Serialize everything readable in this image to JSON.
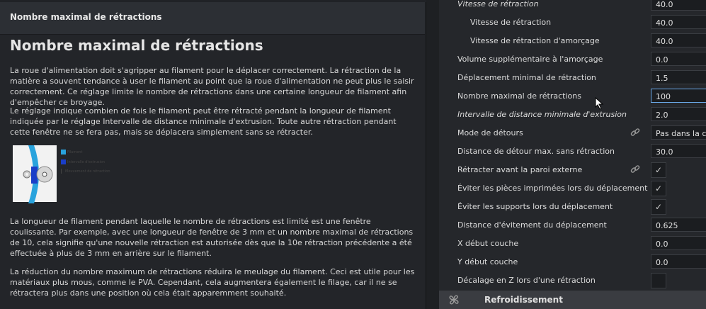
{
  "tooltip": {
    "header_title": "Nombre maximal de rétractions",
    "title": "Nombre maximal de rétractions",
    "paragraphs": [
      "La roue d'alimentation doit s'agripper au filament pour le déplacer correctement. La rétraction de la matière a souvent tendance à user le filament au point que la roue d'alimentation ne peut plus le saisir correctement. Ce réglage limite le nombre de rétractions dans une certaine longueur de filament afin d'empêcher ce broyage.",
      "Le réglage indique combien de fois le filament peut être rétracté pendant la longueur de filament indiquée par le réglage Intervalle de distance minimale d'extrusion. Toute autre rétraction pendant cette fenêtre ne se fera pas, mais se déplacera simplement sans se rétracter.",
      "La longueur de filament pendant laquelle le nombre de rétractions est limité est une fenêtre coulissante. Par exemple, avec une longueur de fenêtre de 3 mm et un nombre maximal de rétractions de 10, cela signifie qu'une nouvelle rétraction est autorisée dès que la 10e rétraction précédente a été effectuée à plus de 3 mm en arrière sur le filament.",
      "La réduction du nombre maximum de rétractions réduira le meulage du filament. Ceci est utile pour les matériaux plus mous, comme le PVA. Cependant, cela augmentera également le filage, car il ne se rétractera plus dans une position où cela était apparemment souhaité."
    ],
    "diagram_legend": [
      "Filament",
      "Intervalle d'extrusion",
      "Mouvement de rétraction"
    ],
    "colors": {
      "filament": "#29a3dd",
      "interval": "#1a3ec8"
    }
  },
  "settings": {
    "rows": [
      {
        "label": "Vitesse de rétraction",
        "value": "40.0",
        "indent": false,
        "italic": true,
        "kind": "field"
      },
      {
        "label": "Vitesse de rétraction",
        "value": "40.0",
        "indent": true,
        "italic": false,
        "kind": "field"
      },
      {
        "label": "Vitesse de rétraction d'amorçage",
        "value": "40.0",
        "indent": true,
        "italic": false,
        "kind": "field"
      },
      {
        "label": "Volume supplémentaire à l'amorçage",
        "value": "0.0",
        "indent": false,
        "italic": false,
        "kind": "field"
      },
      {
        "label": "Déplacement minimal de rétraction",
        "value": "1.5",
        "indent": false,
        "italic": false,
        "kind": "field"
      },
      {
        "label": "Nombre maximal de rétractions",
        "value": "100",
        "indent": false,
        "italic": false,
        "kind": "field",
        "focused": true
      },
      {
        "label": "Intervalle de distance minimale d'extrusion",
        "value": "2.0",
        "indent": false,
        "italic": true,
        "kind": "field"
      },
      {
        "label": "Mode de détours",
        "value": "Pas dans la co",
        "indent": false,
        "italic": false,
        "kind": "field",
        "linked": true
      },
      {
        "label": "Distance de détour max. sans rétraction",
        "value": "30.0",
        "indent": false,
        "italic": false,
        "kind": "field"
      },
      {
        "label": "Rétracter avant la paroi externe",
        "value": "✓",
        "indent": false,
        "italic": false,
        "kind": "check",
        "linked": true
      },
      {
        "label": "Éviter les pièces imprimées lors du déplacement",
        "value": "✓",
        "indent": false,
        "italic": false,
        "kind": "check"
      },
      {
        "label": "Éviter les supports lors du déplacement",
        "value": "✓",
        "indent": false,
        "italic": false,
        "kind": "check"
      },
      {
        "label": "Distance d'évitement du déplacement",
        "value": "0.625",
        "indent": false,
        "italic": false,
        "kind": "field"
      },
      {
        "label": "X début couche",
        "value": "0.0",
        "indent": false,
        "italic": false,
        "kind": "field"
      },
      {
        "label": "Y début couche",
        "value": "0.0",
        "indent": false,
        "italic": false,
        "kind": "field"
      },
      {
        "label": "Décalage en Z lors d'une rétraction",
        "value": "",
        "indent": false,
        "italic": false,
        "kind": "check"
      }
    ],
    "section_title": "Refroidissement"
  }
}
